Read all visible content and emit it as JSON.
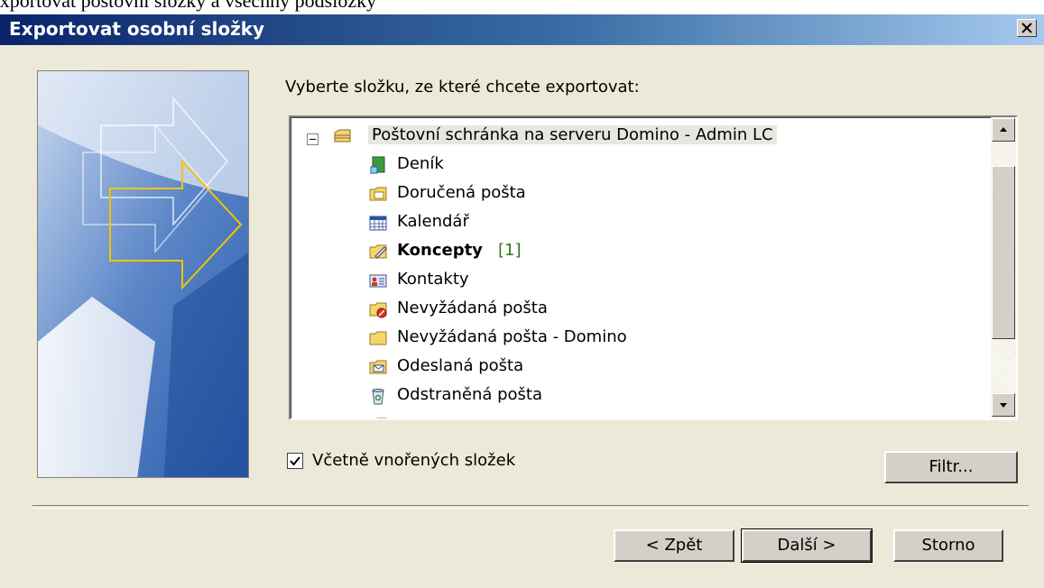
{
  "window": {
    "title": "Exportovat osobní složky"
  },
  "prompt": "Vyberte složku, ze které chcete exportovat:",
  "tree": {
    "root": "Poštovní schránka na serveru Domino - Admin LC",
    "items": [
      {
        "label": "Deník",
        "icon": "journal-icon"
      },
      {
        "label": "Doručená pošta",
        "icon": "inbox-icon"
      },
      {
        "label": "Kalendář",
        "icon": "calendar-icon"
      },
      {
        "label": "Koncepty",
        "count": "[1]",
        "icon": "drafts-icon"
      },
      {
        "label": "Kontakty",
        "icon": "contacts-icon"
      },
      {
        "label": "Nevyžádaná pošta",
        "icon": "junk-mail-icon"
      },
      {
        "label": "Nevyžádaná pošta - Domino",
        "icon": "folder-icon"
      },
      {
        "label": "Odeslaná pošta",
        "icon": "sent-mail-icon"
      },
      {
        "label": "Odstraněná pošta",
        "icon": "deleted-items-icon"
      }
    ]
  },
  "include_subfolders": {
    "label": "Včetně vnořených složek",
    "checked": true
  },
  "buttons": {
    "filter": "Filtr...",
    "back": "< Zpět",
    "next": "Další >",
    "cancel": "Storno"
  }
}
